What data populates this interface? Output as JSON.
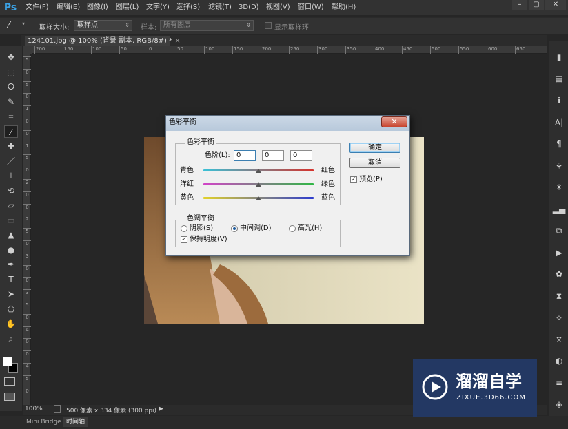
{
  "app": {
    "logo": "Ps"
  },
  "menu": [
    "文件(F)",
    "编辑(E)",
    "图像(I)",
    "图层(L)",
    "文字(Y)",
    "选择(S)",
    "滤镜(T)",
    "3D(D)",
    "视图(V)",
    "窗口(W)",
    "帮助(H)"
  ],
  "window_controls": {
    "minimize": "–",
    "restore": "▢",
    "close": "✕"
  },
  "options_bar": {
    "sample_size_label": "取样大小:",
    "sample_size_value": "取样点",
    "sample_label": "样本:",
    "sample_value": "所有图层",
    "show_ring_label": "显示取样环"
  },
  "document_tab": {
    "title": "124101.jpg @ 100% (背景 副本, RGB/8#) *",
    "close": "×"
  },
  "ruler_h_ticks": [
    "200",
    "150",
    "100",
    "50",
    "0",
    "50",
    "100",
    "150",
    "200",
    "250",
    "300",
    "350",
    "400",
    "450",
    "500",
    "550",
    "600",
    "650"
  ],
  "ruler_v_ticks": [
    "5",
    "0",
    "5",
    "0",
    "1",
    "0",
    "0",
    "1",
    "5",
    "0",
    "2",
    "0",
    "0",
    "2",
    "5",
    "0",
    "3",
    "0",
    "0",
    "3",
    "5",
    "0",
    "4",
    "0",
    "0",
    "4",
    "5",
    "0"
  ],
  "tools": [
    "move-tool",
    "marquee-tool",
    "lasso-tool",
    "quick-select-tool",
    "crop-tool",
    "eyedropper-tool",
    "healing-tool",
    "brush-tool",
    "stamp-tool",
    "history-brush-tool",
    "eraser-tool",
    "gradient-tool",
    "blur-tool",
    "dodge-tool",
    "pen-tool",
    "type-tool",
    "path-select-tool",
    "shape-tool",
    "hand-tool",
    "zoom-tool"
  ],
  "tool_glyphs": [
    "✥",
    "⬚",
    "ⵔ",
    "✎",
    "⌗",
    "⁄",
    "✚",
    "／",
    "⊥",
    "⟲",
    "▱",
    "▭",
    "▲",
    "●",
    "✒",
    "T",
    "➤",
    "⬠",
    "✋",
    "⌕"
  ],
  "right_panel_icons": [
    "layers-comp-icon",
    "document-icon",
    "info-icon",
    "character-icon",
    "paragraph-icon",
    "brush-preset-icon",
    "adjust-icon",
    "histogram-icon",
    "clone-source-icon",
    "actions-play-icon",
    "styles-icon",
    "swatches-icon",
    "properties-icon",
    "paths-icon",
    "color-icon",
    "adjustments-icon",
    "layers-icon"
  ],
  "right_panel_glyphs": [
    "▮",
    "▤",
    "ℹ",
    "A|",
    "¶",
    "⚘",
    "☀",
    "▂▄",
    "⧉",
    "▶",
    "✿",
    "⧗",
    "⟡",
    "⧖",
    "◐",
    "≡",
    "◈"
  ],
  "status_bar": {
    "zoom": "100%",
    "info": "500 像素 x 334 像素 (300 ppi)",
    "arrow": "▶"
  },
  "bottom_tabs": [
    "Mini Bridge",
    "时间轴"
  ],
  "dialog": {
    "title": "色彩平衡",
    "close": "✕",
    "color_balance_group": "色彩平衡",
    "levels_label": "色阶(L):",
    "levels": [
      "0",
      "0",
      "0"
    ],
    "sliders": [
      {
        "left": "青色",
        "right": "红色",
        "value": 0,
        "colors": [
          "#3ac1d7",
          "#d5332d"
        ]
      },
      {
        "left": "洋红",
        "right": "绿色",
        "value": 0,
        "colors": [
          "#d244c8",
          "#30b745"
        ]
      },
      {
        "left": "黄色",
        "right": "蓝色",
        "value": 0,
        "colors": [
          "#e2d22a",
          "#2d3ccf"
        ]
      }
    ],
    "tone_group": "色调平衡",
    "tones": [
      {
        "label": "阴影(S)",
        "selected": false
      },
      {
        "label": "中间调(D)",
        "selected": true
      },
      {
        "label": "高光(H)",
        "selected": false
      }
    ],
    "preserve_luminosity": {
      "label": "保持明度(V)",
      "checked": true
    },
    "ok": "确定",
    "cancel": "取消",
    "preview": {
      "label": "预览(P)",
      "checked": true
    }
  },
  "watermark": {
    "brand": "溜溜自学",
    "site": "ZIXUE.3D66.COM"
  }
}
